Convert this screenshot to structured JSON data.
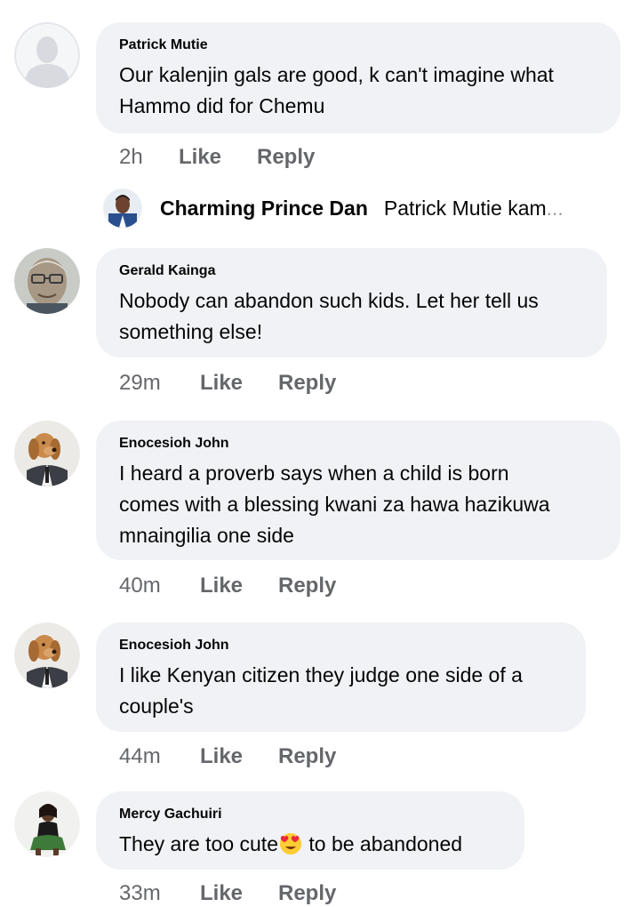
{
  "comments": [
    {
      "author": "Patrick Mutie",
      "text": "Our kalenjin gals are good, k can't imagine what\nHammo did for Chemu",
      "time": "2h",
      "like": "Like",
      "reply": "Reply",
      "avatar": "default-profile-icon"
    },
    {
      "author": "Gerald Kainga",
      "text": "Nobody can abandon such kids. Let her tell us\nsomething else!",
      "time": "29m",
      "like": "Like",
      "reply": "Reply",
      "avatar": "gerald-avatar"
    },
    {
      "author": "Enocesioh John",
      "text": "I heard a proverb says when a child is born\ncomes with a blessing kwani za hawa hazikuwa\nmnaingilia one side",
      "time": "40m",
      "like": "Like",
      "reply": "Reply",
      "avatar": "dog-in-suit-avatar"
    },
    {
      "author": "Enocesioh John",
      "text": "I like Kenyan citizen they judge one side of a\ncouple's",
      "time": "44m",
      "like": "Like",
      "reply": "Reply",
      "avatar": "dog-in-suit-avatar"
    },
    {
      "author": "Mercy Gachuiri",
      "text_before_emoji": "They are too cute",
      "emoji": "heart-eyes-emoji",
      "text_after_emoji": " to be abandoned",
      "time": "33m",
      "like": "Like",
      "reply": "Reply",
      "avatar": "mercy-avatar"
    }
  ],
  "reply_preview": {
    "name": "Charming Prince Dan",
    "text": "Patrick Mutie kam",
    "ellipsis": "...",
    "avatar": "prince-dan-avatar"
  },
  "colors": {
    "bubble": "#f0f2f5",
    "meta": "#65676b",
    "text": "#050505"
  }
}
